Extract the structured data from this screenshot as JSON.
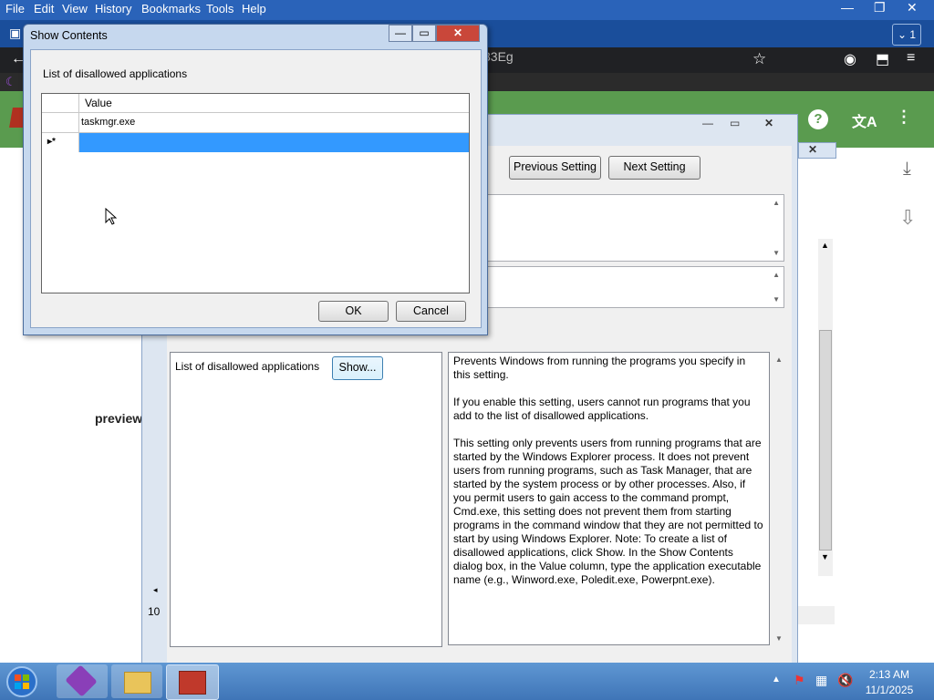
{
  "menu": {
    "file": "File",
    "edit": "Edit",
    "view": "View",
    "history": "History",
    "bookmarks": "Bookmarks",
    "tools": "Tools",
    "help": "Help"
  },
  "browser": {
    "url_fragment": "33Eg",
    "tab_count": "1",
    "page_text": "preview"
  },
  "policy_window": {
    "previous_setting": "Previous Setting",
    "next_setting": "Next Setting",
    "option_label": "List of disallowed applications",
    "show_button": "Show...",
    "help_paragraphs": [
      "Prevents Windows from running the programs you specify in this setting.",
      "If you enable this setting, users cannot run programs that you add to the list of disallowed applications.",
      "This setting only prevents users from running programs that are started by the Windows Explorer process. It does not prevent users from running programs, such as Task Manager, that are started by the system process or by other processes. Also, if you permit users to gain access to the command prompt, Cmd.exe, this setting does not prevent them from starting programs in the command window that they are not permitted to start by using Windows Explorer. Note: To create a list of disallowed applications, click Show. In the Show Contents dialog box, in the Value column, type the application executable name (e.g., Winword.exe, Poledit.exe, Powerpnt.exe)."
    ],
    "left_cut_text": "10"
  },
  "dialog": {
    "title": "Show Contents",
    "list_label": "List of disallowed applications",
    "column_header": "Value",
    "rows": [
      "taskmgr.exe"
    ],
    "new_row_marker": "▸*",
    "ok": "OK",
    "cancel": "Cancel"
  },
  "taskbar": {
    "time": "2:13 AM",
    "date": "11/1/2025"
  }
}
